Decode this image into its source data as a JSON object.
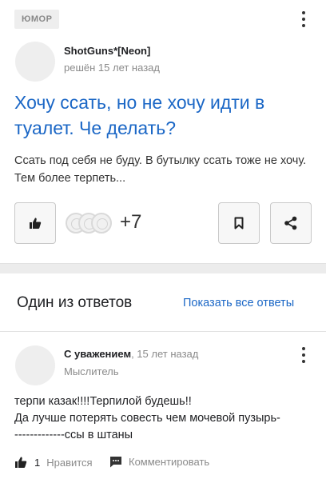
{
  "question": {
    "category": "Юмор",
    "author": "ShotGuns*[Neon]",
    "meta": "решён 15 лет назад",
    "title": "Хочу ссать, но не хочу идти в туалет. Че делать?",
    "body": "Ссать под себя не буду. В бутылку ссать тоже не хочу. Тем более терпеть...",
    "likes_extra": "+7"
  },
  "answers": {
    "heading": "Один из ответов",
    "show_all": "Показать все ответы",
    "answer": {
      "author": "С уважением",
      "time": ", 15 лет назад",
      "rank": "Мыслитель",
      "body_lines": [
        "терпи казак!!!!Терпилой будешь!!",
        "Да лучше потерять совесть чем мочевой пузырь-",
        "-------------ссы в штаны"
      ],
      "like_count": "1",
      "like_label": "Нравится",
      "comment_label": "Комментировать"
    }
  },
  "icons": {
    "like": "thumbs-up-icon",
    "bookmark": "bookmark-icon",
    "share": "share-icon",
    "menu": "more-vertical-icon",
    "comment": "comment-icon"
  },
  "colors": {
    "link": "#1b67c6",
    "muted": "#8a8a8a",
    "background": "#ececec"
  }
}
